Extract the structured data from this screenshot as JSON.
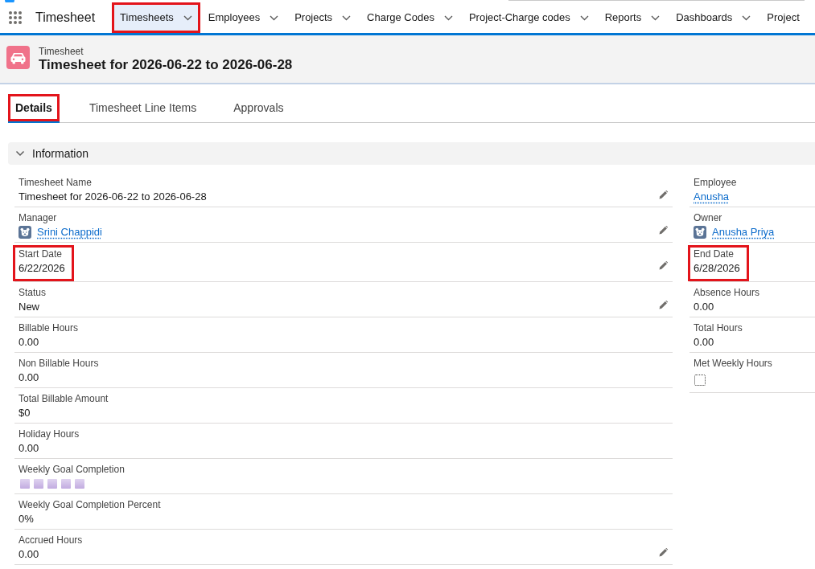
{
  "app_name": "Timesheet",
  "nav_tabs": [
    {
      "label": "Timesheets",
      "selected": true,
      "highlighted": true,
      "menu": true
    },
    {
      "label": "Employees",
      "selected": false,
      "highlighted": false,
      "menu": true
    },
    {
      "label": "Projects",
      "selected": false,
      "highlighted": false,
      "menu": true
    },
    {
      "label": "Charge Codes",
      "selected": false,
      "highlighted": false,
      "menu": true
    },
    {
      "label": "Project-Charge codes",
      "selected": false,
      "highlighted": false,
      "menu": true
    },
    {
      "label": "Reports",
      "selected": false,
      "highlighted": false,
      "menu": true
    },
    {
      "label": "Dashboards",
      "selected": false,
      "highlighted": false,
      "menu": true
    },
    {
      "label": "Project",
      "selected": false,
      "highlighted": false,
      "menu": false
    }
  ],
  "record": {
    "object_type": "Timesheet",
    "title": "Timesheet for 2026-06-22 to 2026-06-28"
  },
  "record_tabs": [
    {
      "label": "Details",
      "selected": true,
      "highlighted": true
    },
    {
      "label": "Timesheet Line Items",
      "selected": false,
      "highlighted": false
    },
    {
      "label": "Approvals",
      "selected": false,
      "highlighted": false
    }
  ],
  "section": {
    "title": "Information",
    "expanded": true,
    "left_fields": [
      {
        "kind": "text",
        "label": "Timesheet Name",
        "value": "Timesheet for 2026-06-22 to 2026-06-28",
        "editable": true,
        "highlighted": false
      },
      {
        "kind": "user",
        "label": "Manager",
        "value": "Srini Chappidi",
        "editable": true,
        "highlighted": false
      },
      {
        "kind": "text",
        "label": "Start Date",
        "value": "6/22/2026",
        "editable": true,
        "highlighted": true
      },
      {
        "kind": "text",
        "label": "Status",
        "value": "New",
        "editable": true,
        "highlighted": false
      },
      {
        "kind": "text",
        "label": "Billable Hours",
        "value": "0.00",
        "editable": false,
        "highlighted": false
      },
      {
        "kind": "text",
        "label": "Non Billable Hours",
        "value": "0.00",
        "editable": false,
        "highlighted": false
      },
      {
        "kind": "text",
        "label": "Total Billable Amount",
        "value": "$0",
        "editable": false,
        "highlighted": false
      },
      {
        "kind": "text",
        "label": "Holiday Hours",
        "value": "0.00",
        "editable": false,
        "highlighted": false
      },
      {
        "kind": "rating",
        "label": "Weekly Goal Completion",
        "stars": 5,
        "editable": false,
        "highlighted": false
      },
      {
        "kind": "text",
        "label": "Weekly Goal Completion Percent",
        "value": "0%",
        "editable": false,
        "highlighted": false
      },
      {
        "kind": "text",
        "label": "Accrued Hours",
        "value": "0.00",
        "editable": true,
        "highlighted": false
      }
    ],
    "right_fields": [
      {
        "kind": "link",
        "label": "Employee",
        "value": "Anusha",
        "editable": false,
        "highlighted": false
      },
      {
        "kind": "user",
        "label": "Owner",
        "value": "Anusha Priya",
        "editable": false,
        "highlighted": false
      },
      {
        "kind": "text",
        "label": "End Date",
        "value": "6/28/2026",
        "editable": false,
        "highlighted": true
      },
      {
        "kind": "text",
        "label": "Absence Hours",
        "value": "0.00",
        "editable": false,
        "highlighted": false
      },
      {
        "kind": "text",
        "label": "Total Hours",
        "value": "0.00",
        "editable": false,
        "highlighted": false
      },
      {
        "kind": "checkbox",
        "label": "Met Weekly Hours",
        "checked": false,
        "editable": false,
        "highlighted": false
      }
    ]
  }
}
